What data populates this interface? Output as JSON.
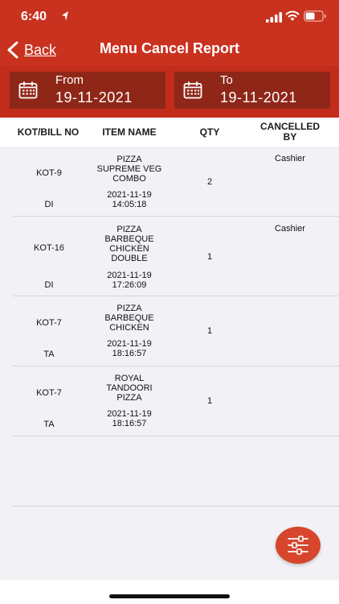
{
  "status_bar": {
    "time": "6:40"
  },
  "nav": {
    "back_label": "Back",
    "title": "Menu Cancel Report"
  },
  "filters": {
    "from": {
      "label": "From",
      "value": "19-11-2021"
    },
    "to": {
      "label": "To",
      "value": "19-11-2021"
    }
  },
  "table": {
    "headers": {
      "kot": "KOT/BILL NO",
      "item": "ITEM NAME",
      "qty": "QTY",
      "cancelled_line1": "CANCELLED",
      "cancelled_line2": "BY"
    },
    "rows": [
      {
        "kot": "KOT-9",
        "type": "DI",
        "item_lines": [
          "PIZZA",
          "SUPREME VEG",
          "COMBO"
        ],
        "date": "2021-11-19",
        "time": "14:05:18",
        "qty": "2",
        "cancelled_by": "Cashier"
      },
      {
        "kot": "KOT-16",
        "type": "DI",
        "item_lines": [
          "PIZZA",
          "BARBEQUE",
          "CHICKEN",
          "DOUBLE"
        ],
        "date": "2021-11-19",
        "time": "17:26:09",
        "qty": "1",
        "cancelled_by": "Cashier"
      },
      {
        "kot": "KOT-7",
        "type": "TA",
        "item_lines": [
          "PIZZA",
          "BARBEQUE",
          "CHICKEN"
        ],
        "date": "2021-11-19",
        "time": "18:16:57",
        "qty": "1",
        "cancelled_by": ""
      },
      {
        "kot": "KOT-7",
        "type": "TA",
        "item_lines": [
          "ROYAL",
          "TANDOORI",
          "PIZZA"
        ],
        "date": "2021-11-19",
        "time": "18:16:57",
        "qty": "1",
        "cancelled_by": ""
      }
    ]
  },
  "fab": {
    "icon": "filter-sliders-icon"
  },
  "colors": {
    "primary": "#c9321f",
    "date_box": "#8f2718",
    "fab": "#d6452c"
  }
}
